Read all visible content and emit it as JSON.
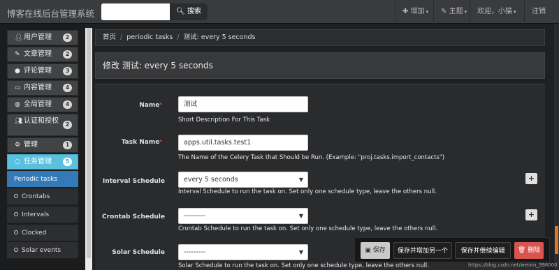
{
  "navbar": {
    "brand": "博客在线后台管理系统",
    "search_button": "搜索",
    "add_label": "增加",
    "theme_label": "主题",
    "welcome": "欢迎，小猫",
    "logout": "注销"
  },
  "sidebar": {
    "items": [
      {
        "label": "用户管理",
        "badge": "2",
        "icon": "user-icon"
      },
      {
        "label": "文章管理",
        "badge": "2",
        "icon": "edit-icon"
      },
      {
        "label": "评论管理",
        "badge": "3",
        "icon": "comments-icon"
      },
      {
        "label": "内容管理",
        "badge": "4",
        "icon": "window-icon"
      },
      {
        "label": "全局管理",
        "badge": "4",
        "icon": "globe-icon"
      },
      {
        "label": "认证和授权",
        "badge": "2",
        "icon": "users-icon"
      },
      {
        "label": "管理",
        "badge": "1",
        "icon": "gear-icon"
      },
      {
        "label": "任务管理",
        "badge": "5",
        "icon": "circle-icon"
      }
    ],
    "sub_items": [
      {
        "label": "Periodic tasks"
      },
      {
        "label": "Crontabs"
      },
      {
        "label": "Intervals"
      },
      {
        "label": "Clocked"
      },
      {
        "label": "Solar events"
      }
    ]
  },
  "breadcrumb": {
    "home": "首页",
    "section": "periodic tasks",
    "current": "测试: every 5 seconds"
  },
  "page_title": "修改 测试: every 5 seconds",
  "form": {
    "name": {
      "label": "Name",
      "value": "测试",
      "help": "Short Description For This Task"
    },
    "task_name": {
      "label": "Task Name",
      "value": "apps.util.tasks.test1",
      "help": "The Name of the Celery Task that Should be Run. (Example: \"proj.tasks.import_contacts\")"
    },
    "interval": {
      "label": "Interval Schedule",
      "value": "every 5 seconds",
      "help": "Interval Schedule to run the task on. Set only one schedule type, leave the others null."
    },
    "crontab": {
      "label": "Crontab Schedule",
      "value": "---------",
      "help": "Crontab Schedule to run the task on. Set only one schedule type, leave the others null."
    },
    "solar": {
      "label": "Solar Schedule",
      "value": "---------",
      "help": "Solar Schedule to run the task on. Set only one schedule type, leave the others null."
    },
    "plus": "+"
  },
  "actions": {
    "save": "保存",
    "save_add": "保存并增加另一个",
    "save_continue": "保存并继续编辑",
    "delete": "删除"
  },
  "watermark": "https://blog.csdn.net/weixin_398000",
  "colors": {
    "active_menu": "#5bc0de",
    "active_sub": "#337ab7",
    "delete": "#d9534f"
  }
}
